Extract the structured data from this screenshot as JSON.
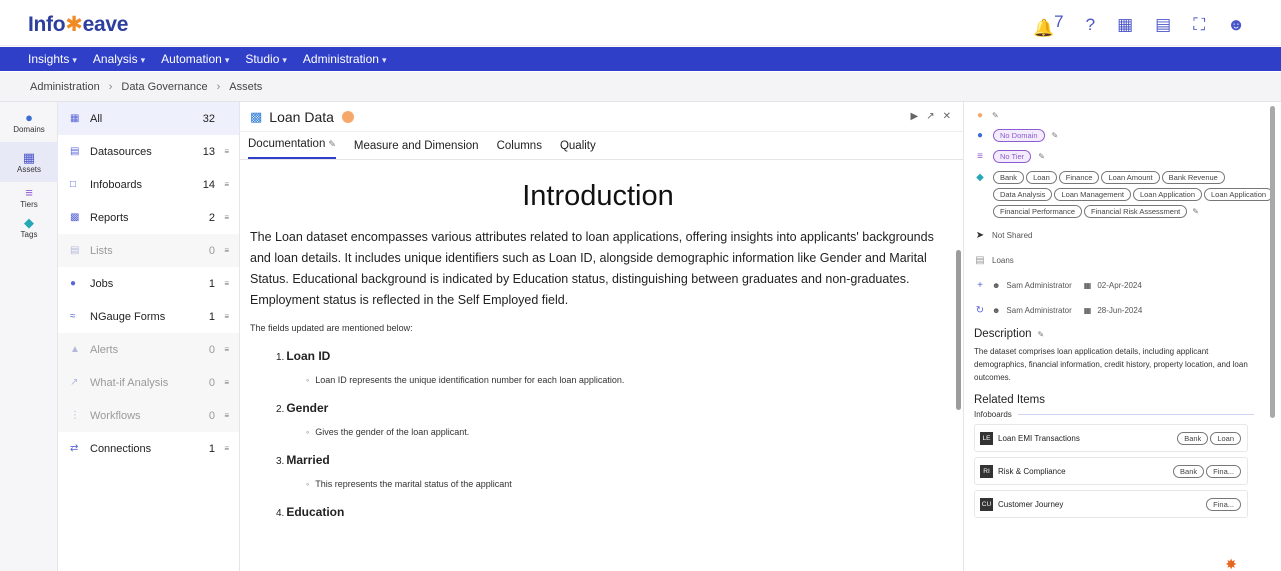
{
  "app": {
    "logo_left": "Info",
    "logo_accent": "✱",
    "logo_right": "eave"
  },
  "header": {
    "bell_count": "7",
    "icons": [
      "bell-icon",
      "help-icon",
      "library-icon",
      "monitor-icon",
      "fullscreen-icon",
      "user-avatar"
    ]
  },
  "nav": [
    {
      "label": "Insights"
    },
    {
      "label": "Analysis"
    },
    {
      "label": "Automation"
    },
    {
      "label": "Studio"
    },
    {
      "label": "Administration"
    }
  ],
  "breadcrumb": [
    "Administration",
    "Data Governance",
    "Assets"
  ],
  "rail": [
    {
      "label": "Domains",
      "icon": "globe-icon"
    },
    {
      "label": "Assets",
      "icon": "library-icon"
    },
    {
      "label": "Tiers",
      "icon": "layers-icon"
    },
    {
      "label": "Tags",
      "icon": "tag-icon"
    }
  ],
  "assets": [
    {
      "label": "All",
      "count": "32",
      "icon": "grid-icon",
      "state": "active"
    },
    {
      "label": "Datasources",
      "count": "13",
      "icon": "database-icon",
      "state": "normal"
    },
    {
      "label": "Infoboards",
      "count": "14",
      "icon": "board-icon",
      "state": "normal"
    },
    {
      "label": "Reports",
      "count": "2",
      "icon": "report-icon",
      "state": "normal"
    },
    {
      "label": "Lists",
      "count": "0",
      "icon": "list-icon",
      "state": "muted"
    },
    {
      "label": "Jobs",
      "count": "1",
      "icon": "job-icon",
      "state": "normal"
    },
    {
      "label": "NGauge Forms",
      "count": "1",
      "icon": "form-icon",
      "state": "normal"
    },
    {
      "label": "Alerts",
      "count": "0",
      "icon": "alert-icon",
      "state": "muted"
    },
    {
      "label": "What-if Analysis",
      "count": "0",
      "icon": "chart-icon",
      "state": "muted"
    },
    {
      "label": "Workflows",
      "count": "0",
      "icon": "workflow-icon",
      "state": "muted"
    },
    {
      "label": "Connections",
      "count": "1",
      "icon": "connection-icon",
      "state": "normal"
    }
  ],
  "main": {
    "title": "Loan Data",
    "tabs": [
      {
        "label": "Documentation",
        "active": true
      },
      {
        "label": "Measure and Dimension",
        "active": false
      },
      {
        "label": "Columns",
        "active": false
      },
      {
        "label": "Quality",
        "active": false
      }
    ],
    "doc_heading": "Introduction",
    "intro": "The Loan dataset encompasses various attributes related to loan applications, offering insights into applicants' backgrounds and loan details. It includes unique identifiers such as Loan ID, alongside demographic information like Gender and Marital Status. Educational background is indicated by Education status, distinguishing between graduates and non-graduates. Employment status is reflected in the Self Employed field.",
    "fields_intro": "The fields updated are mentioned below:",
    "fields": [
      {
        "num": "1.",
        "name": "Loan ID",
        "desc": "Loan ID represents the unique identification number for each loan application."
      },
      {
        "num": "2.",
        "name": "Gender",
        "desc": "Gives the gender of the loan applicant."
      },
      {
        "num": "3.",
        "name": "Married",
        "desc": "This represents the marital status of the applicant"
      },
      {
        "num": "4.",
        "name": "Education",
        "desc": ""
      }
    ]
  },
  "right": {
    "domain": "No Domain",
    "tier": "No Tier",
    "tags": [
      "Bank",
      "Loan",
      "Finance",
      "Loan Amount",
      "Bank Revenue",
      "Data Analysis",
      "Loan Management",
      "Loan Application",
      "Loan Application",
      "Financial Performance",
      "Financial Risk Assessment"
    ],
    "shared": "Not Shared",
    "category": "Loans",
    "created_by": "Sam Administrator",
    "created_date": "02-Apr-2024",
    "updated_by": "Sam Administrator",
    "updated_date": "28-Jun-2024",
    "description_heading": "Description",
    "description": "The dataset comprises loan application details, including applicant demographics, financial information, credit history, property location, and loan outcomes.",
    "related_heading": "Related Items",
    "related_group": "Infoboards",
    "related": [
      {
        "badge": "LE",
        "name": "Loan EMI Transactions",
        "chips": [
          "Bank",
          "Loan"
        ]
      },
      {
        "badge": "RI",
        "name": "Risk & Compliance",
        "chips": [
          "Bank",
          "Fina..."
        ]
      },
      {
        "badge": "CU",
        "name": "Customer Journey",
        "chips": [
          "Fina..."
        ]
      }
    ]
  },
  "colors": {
    "brand": "#2f3fc8",
    "accent": "#f08a24",
    "tier": "#f6a86a",
    "purple": "#8e5bd1"
  }
}
